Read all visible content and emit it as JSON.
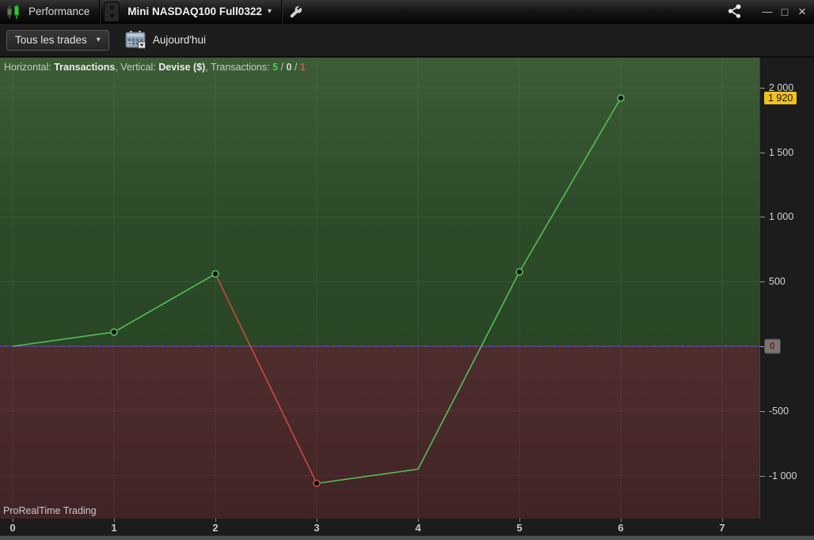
{
  "titlebar": {
    "app_title": "Performance",
    "instrument": "Mini NASDAQ100 Full0322",
    "instrument_caret": "▾",
    "icons": {
      "app": "candlestick-chart",
      "grip": "panel-grip",
      "tools": "wrench",
      "share": "share-network",
      "minimize_glyph": "—",
      "maximize_glyph": "□",
      "close_glyph": "×"
    }
  },
  "toolbar": {
    "trades_filter_label": "Tous les trades",
    "trades_filter_caret": "▾",
    "calendar_icon": "calendar",
    "period_label": "Aujourd'hui"
  },
  "legend": {
    "horizontal_label": "Horizontal: ",
    "horizontal_value": "Transactions",
    "vertical_label": ", Vertical: ",
    "vertical_value": "Devise ($)",
    "transactions_label": ", Transactions: ",
    "wins": "5",
    "sep_a": " / ",
    "neutral": "0",
    "sep_b": " / ",
    "losses": "1"
  },
  "watermark": "ProRealTime Trading",
  "chart_data": {
    "type": "line",
    "xlabel": "Transactions",
    "ylabel": "Devise ($)",
    "x": [
      0,
      1,
      2,
      3,
      4,
      5,
      6
    ],
    "values": [
      0,
      110,
      560,
      -1060,
      -950,
      575,
      1920
    ],
    "x_tick_labels": [
      "0",
      "1",
      "2",
      "3",
      "4",
      "5",
      "6",
      "7"
    ],
    "y_ticks": [
      {
        "v": 2000,
        "label": "2 000"
      },
      {
        "v": 1500,
        "label": "1 500"
      },
      {
        "v": 1000,
        "label": "1 000"
      },
      {
        "v": 500,
        "label": "500"
      },
      {
        "v": 0,
        "label": "0"
      },
      {
        "v": -500,
        "label": "-500"
      },
      {
        "v": -1000,
        "label": "-1 000"
      }
    ],
    "last_value": 1920,
    "last_value_label": "1 920",
    "xlim": [
      -0.125,
      7.375
    ],
    "ylim": [
      -1333,
      2232
    ],
    "grid": true,
    "legend_position": "top-left",
    "marker_indices": [
      1,
      2,
      3,
      5,
      6
    ],
    "colors": {
      "gain_line": "#55bd58",
      "loss_line": "#c94b41",
      "marker_fill": "#0c130c",
      "zero_line_blue": "#3d3ddb",
      "zero_line_alt": "#b2552f",
      "grid_line": "rgba(255,255,255,0.06)",
      "positive_bg_top": "#3d5c37",
      "positive_bg_bottom": "#294726",
      "negative_bg_top": "#4e2d2d",
      "negative_bg_bottom": "#402425",
      "last_value_badge_bg": "#f0c11e",
      "last_value_badge_text": "#151400",
      "zero_badge_bg": "#757575",
      "zero_badge_text": "#7c2020"
    }
  }
}
